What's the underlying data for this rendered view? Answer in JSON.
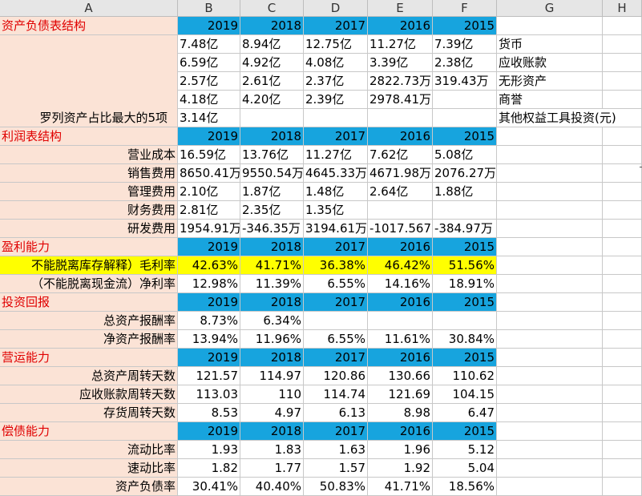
{
  "column_headers": [
    "A",
    "B",
    "C",
    "D",
    "E",
    "F",
    "G",
    "H"
  ],
  "years": [
    "2019",
    "2018",
    "2017",
    "2016",
    "2015"
  ],
  "balance": {
    "title": "资产负债表结构",
    "label": "罗列资产占比最大的5项",
    "rows": [
      [
        "7.48亿",
        "8.94亿",
        "12.75亿",
        "11.27亿",
        "7.39亿"
      ],
      [
        "6.59亿",
        "4.92亿",
        "4.08亿",
        "3.39亿",
        "2.38亿"
      ],
      [
        "2.57亿",
        "2.61亿",
        "2.37亿",
        "2822.73万",
        "319.43万"
      ],
      [
        "4.18亿",
        "4.20亿",
        "2.39亿",
        "2978.41万",
        ""
      ],
      [
        "3.14亿",
        "",
        "",
        "",
        ""
      ]
    ],
    "legend": [
      "货币",
      "应收账款",
      "无形资产",
      "商誉",
      "其他权益工具投资(元)"
    ]
  },
  "profit": {
    "title": "利润表结构",
    "rows": [
      {
        "label": "营业成本",
        "values": [
          "16.59亿",
          "13.76亿",
          "11.27亿",
          "7.62亿",
          "5.08亿"
        ]
      },
      {
        "label": "销售费用",
        "values": [
          "8650.41万",
          "9550.54万",
          "4645.33万",
          "4671.98万",
          "2076.27万"
        ]
      },
      {
        "label": "管理费用",
        "values": [
          "2.10亿",
          "1.87亿",
          "1.48亿",
          "2.64亿",
          "1.88亿"
        ]
      },
      {
        "label": "财务费用",
        "values": [
          "2.81亿",
          "2.35亿",
          "1.35亿",
          "",
          ""
        ]
      },
      {
        "label": "研发费用",
        "values": [
          "1954.91万",
          "-346.35万",
          "3194.61万",
          "-1017.567",
          "-384.97万"
        ]
      }
    ]
  },
  "profitability": {
    "title": "盈利能力",
    "rows": [
      {
        "label": "不能脱离库存解释）毛利率",
        "values": [
          "42.63%",
          "41.71%",
          "36.38%",
          "46.42%",
          "51.56%"
        ]
      },
      {
        "label": "（不能脱离现金流）净利率",
        "values": [
          "12.98%",
          "11.39%",
          "6.55%",
          "14.16%",
          "18.91%"
        ]
      }
    ]
  },
  "investment": {
    "title": "投资回报",
    "rows": [
      {
        "label": "总资产报酬率",
        "values": [
          "8.73%",
          "6.34%",
          "",
          "",
          ""
        ]
      },
      {
        "label": "净资产报酬率",
        "values": [
          "13.94%",
          "11.96%",
          "6.55%",
          "11.61%",
          "30.84%"
        ]
      }
    ]
  },
  "operating": {
    "title": "营运能力",
    "rows": [
      {
        "label": "总资产周转天数",
        "values": [
          "121.57",
          "114.97",
          "120.86",
          "130.66",
          "110.62"
        ]
      },
      {
        "label": "应收账款周转天数",
        "values": [
          "113.03",
          "110",
          "114.74",
          "121.69",
          "104.15"
        ]
      },
      {
        "label": "存货周转天数",
        "values": [
          "8.53",
          "4.97",
          "6.13",
          "8.98",
          "6.47"
        ]
      }
    ]
  },
  "solvency": {
    "title": "偿债能力",
    "rows": [
      {
        "label": "流动比率",
        "values": [
          "1.93",
          "1.83",
          "1.63",
          "1.96",
          "5.12"
        ]
      },
      {
        "label": "速动比率",
        "values": [
          "1.82",
          "1.77",
          "1.57",
          "1.92",
          "5.04"
        ]
      },
      {
        "label": "资产负债率",
        "values": [
          "30.41%",
          "40.40%",
          "50.83%",
          "41.71%",
          "18.56%"
        ]
      }
    ]
  },
  "colors": {
    "blue": "#17a4de",
    "peach": "#fbe3d6",
    "yellow": "#ffff00",
    "red": "#e00000"
  }
}
